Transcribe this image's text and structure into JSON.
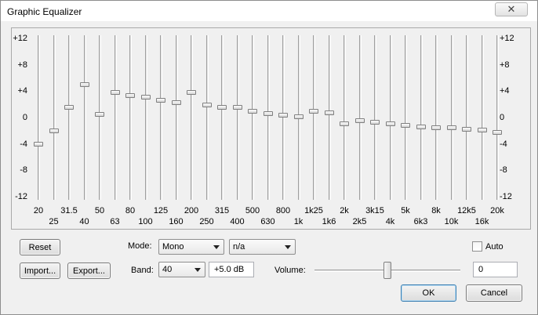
{
  "window": {
    "title": "Graphic Equalizer",
    "close_label": "✕"
  },
  "scale_labels": [
    "+12",
    "+8",
    "+4",
    "0",
    "-4",
    "-8",
    "-12"
  ],
  "bands": [
    {
      "label": "20",
      "gain": -4.0
    },
    {
      "label": "25",
      "gain": -2.0
    },
    {
      "label": "31.5",
      "gain": 1.5
    },
    {
      "label": "40",
      "gain": 5.0
    },
    {
      "label": "50",
      "gain": 0.5
    },
    {
      "label": "63",
      "gain": 3.8
    },
    {
      "label": "80",
      "gain": 3.3
    },
    {
      "label": "100",
      "gain": 3.1
    },
    {
      "label": "125",
      "gain": 2.6
    },
    {
      "label": "160",
      "gain": 2.2
    },
    {
      "label": "200",
      "gain": 3.8
    },
    {
      "label": "250",
      "gain": 1.9
    },
    {
      "label": "315",
      "gain": 1.6
    },
    {
      "label": "400",
      "gain": 1.5
    },
    {
      "label": "500",
      "gain": 0.9
    },
    {
      "label": "630",
      "gain": 0.6
    },
    {
      "label": "800",
      "gain": 0.4
    },
    {
      "label": "1k",
      "gain": 0.1
    },
    {
      "label": "1k25",
      "gain": 0.9
    },
    {
      "label": "1k6",
      "gain": 0.7
    },
    {
      "label": "2k",
      "gain": -0.9
    },
    {
      "label": "2k5",
      "gain": -0.5
    },
    {
      "label": "3k15",
      "gain": -0.7
    },
    {
      "label": "4k",
      "gain": -0.9
    },
    {
      "label": "5k",
      "gain": -1.2
    },
    {
      "label": "6k3",
      "gain": -1.4
    },
    {
      "label": "8k",
      "gain": -1.5
    },
    {
      "label": "10k",
      "gain": -1.6
    },
    {
      "label": "12k5",
      "gain": -1.8
    },
    {
      "label": "16k",
      "gain": -1.9
    },
    {
      "label": "20k",
      "gain": -2.2
    }
  ],
  "controls": {
    "reset_label": "Reset",
    "import_label": "Import...",
    "export_label": "Export...",
    "mode_label": "Mode:",
    "mode_value": "Mono",
    "channel_value": "n/a",
    "band_label": "Band:",
    "band_value": "40",
    "gain_value": "+5.0 dB",
    "auto_label": "Auto",
    "auto_checked": false,
    "volume_label": "Volume:",
    "volume_value": "0",
    "ok_label": "OK",
    "cancel_label": "Cancel"
  }
}
